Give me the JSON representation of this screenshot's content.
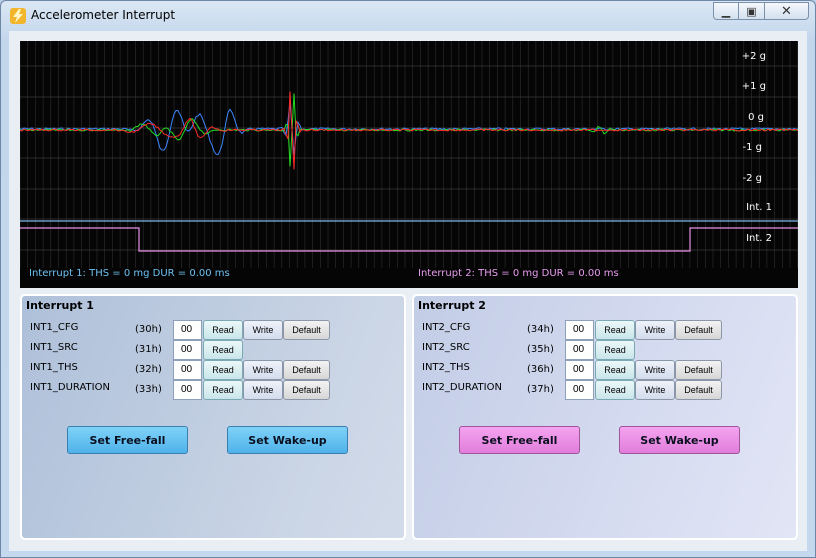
{
  "window": {
    "title": "Accelerometer Interrupt"
  },
  "scope": {
    "y_labels": [
      "+2 g",
      "+1 g",
      "0 g",
      "-1 g",
      "-2 g"
    ],
    "int_labels": [
      "Int. 1",
      "Int. 2"
    ],
    "int1_status": "Interrupt 1: THS = 0 mg  DUR = 0.00 ms",
    "int2_status": "Interrupt 2: THS = 0 mg  DUR = 0.00 ms",
    "colors": {
      "x": "#ff2a2a",
      "y": "#22dd22",
      "z": "#3a86ff",
      "int1": "#7fb8e8",
      "int2": "#e78fe8",
      "int1_text": "#6ec1f2",
      "int2_text": "#e89cf0"
    }
  },
  "interrupt1": {
    "title": "Interrupt 1",
    "registers": [
      {
        "name": "INT1_CFG",
        "addr": "(30h)",
        "value": "00",
        "read": "Read",
        "write": "Write",
        "default": "Default"
      },
      {
        "name": "INT1_SRC",
        "addr": "(31h)",
        "value": "00",
        "read": "Read"
      },
      {
        "name": "INT1_THS",
        "addr": "(32h)",
        "value": "00",
        "read": "Read",
        "write": "Write",
        "default": "Default"
      },
      {
        "name": "INT1_DURATION",
        "addr": "(33h)",
        "value": "00",
        "read": "Read",
        "write": "Write",
        "default": "Default"
      }
    ],
    "freefall_label": "Set Free-fall",
    "wakeup_label": "Set Wake-up"
  },
  "interrupt2": {
    "title": "Interrupt 2",
    "registers": [
      {
        "name": "INT2_CFG",
        "addr": "(34h)",
        "value": "00",
        "read": "Read",
        "write": "Write",
        "default": "Default"
      },
      {
        "name": "INT2_SRC",
        "addr": "(35h)",
        "value": "00",
        "read": "Read"
      },
      {
        "name": "INT2_THS",
        "addr": "(36h)",
        "value": "00",
        "read": "Read",
        "write": "Write",
        "default": "Default"
      },
      {
        "name": "INT2_DURATION",
        "addr": "(37h)",
        "value": "00",
        "read": "Read",
        "write": "Write",
        "default": "Default"
      }
    ],
    "freefall_label": "Set Free-fall",
    "wakeup_label": "Set Wake-up"
  }
}
